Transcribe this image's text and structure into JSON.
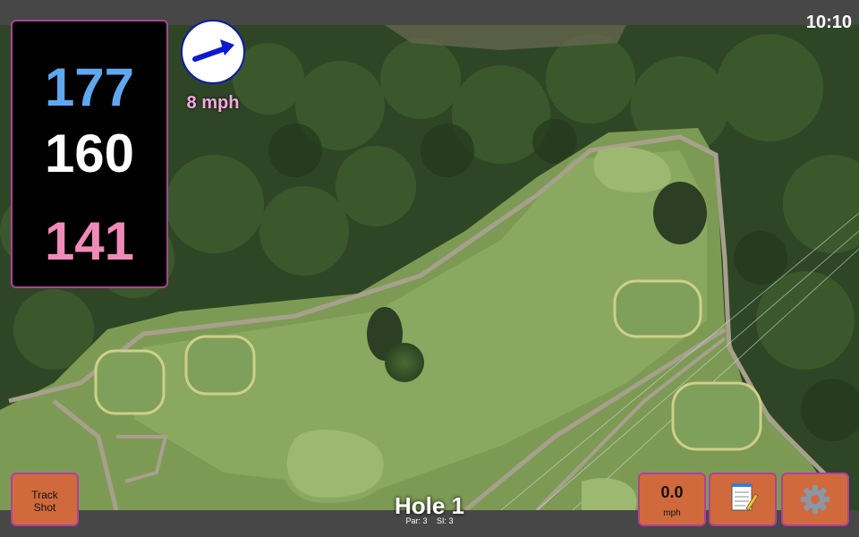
{
  "status_bar": {
    "time": "10:10"
  },
  "distances": {
    "back": "177",
    "middle": "160",
    "front": "141"
  },
  "wind": {
    "speed": "8 mph",
    "direction_icon": "wind-arrow-icon"
  },
  "hole": {
    "title": "Hole 1",
    "par": "Par: 3",
    "stroke_index": "SI: 3"
  },
  "buttons": {
    "track_shot": [
      "Track",
      "Shot"
    ],
    "speed_value": "0.0",
    "speed_unit": "mph",
    "notes_icon": "notepad-icon",
    "settings_icon": "gear-icon"
  },
  "colors": {
    "back_distance": "#5fa8f0",
    "middle_distance": "#ffffff",
    "front_distance": "#f08ab8",
    "button": "#d06a3c",
    "accent_border": "#b0409b"
  }
}
